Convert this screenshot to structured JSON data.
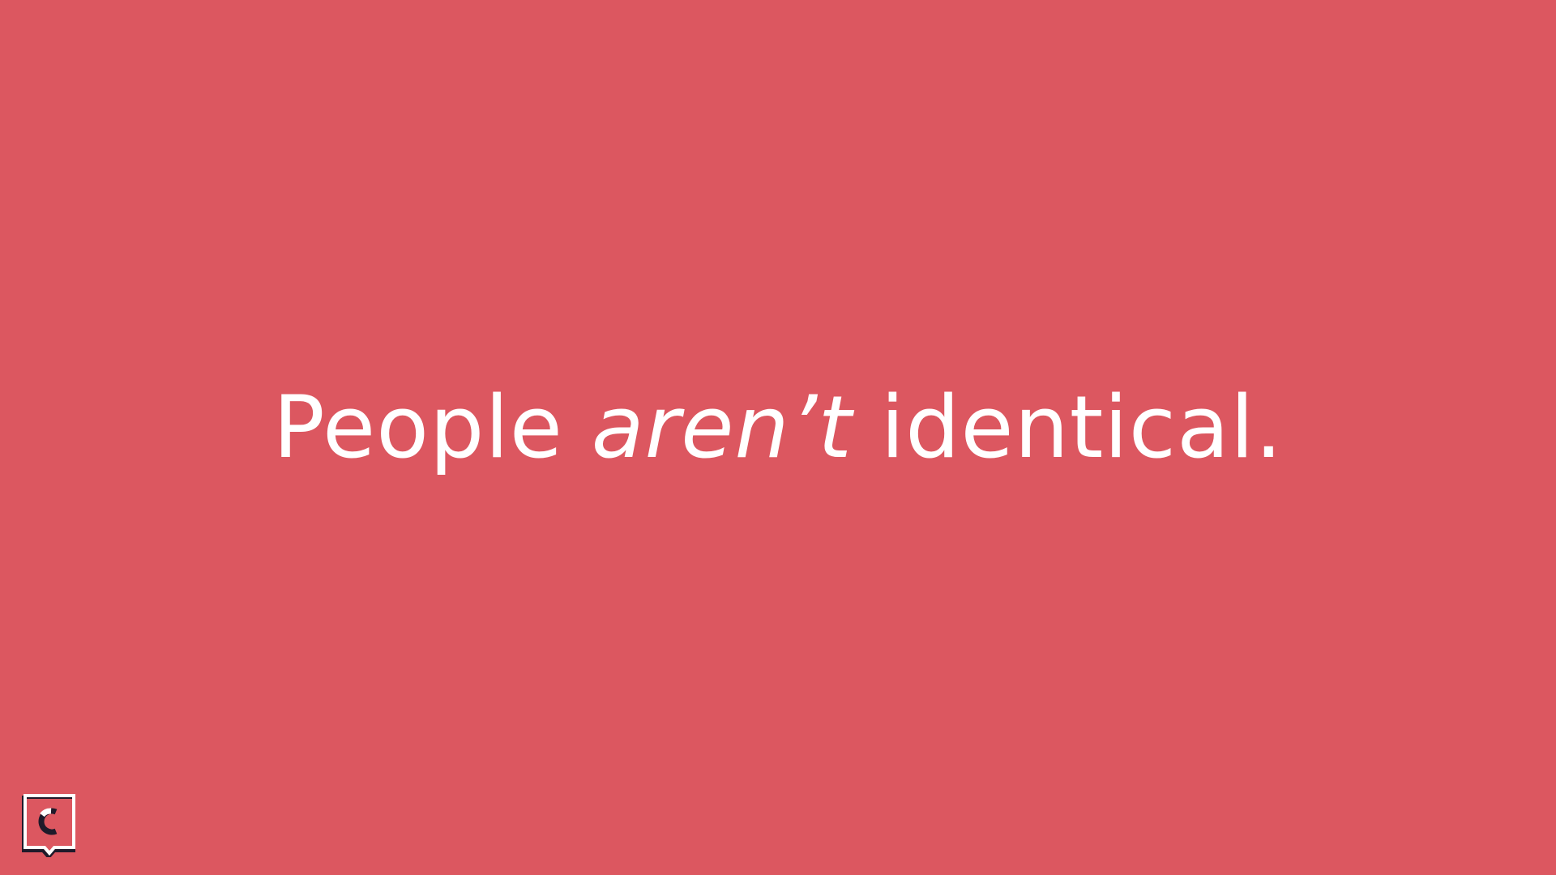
{
  "slide": {
    "background_color": "#dc5760",
    "text_color": "#ffffff",
    "headline": {
      "before": "People ",
      "emphasis": "aren’t",
      "after": " identical."
    },
    "logo": {
      "icon": "speech-bubble-c-logo-icon",
      "frame_color": "#ffffff",
      "shadow_color": "#1f1a2a"
    }
  }
}
